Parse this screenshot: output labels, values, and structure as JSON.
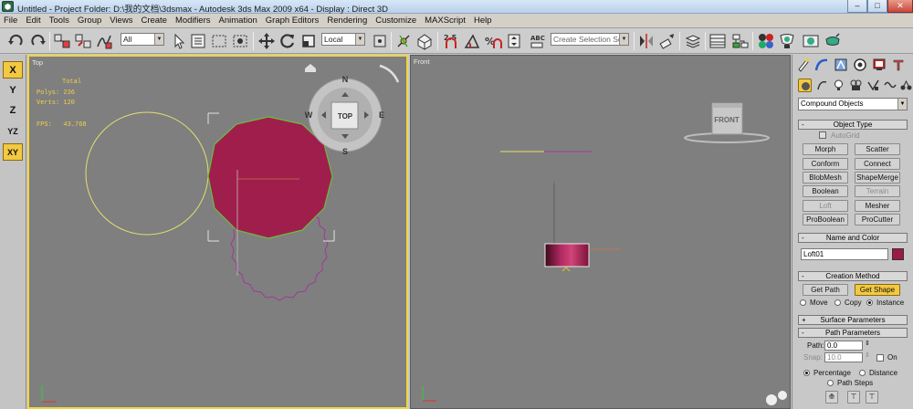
{
  "window": {
    "title": "Untitled      - Project Folder: D:\\我的文档\\3dsmax      - Autodesk 3ds Max  2009 x64      - Display : Direct 3D",
    "app_icon": "3ds-max-icon",
    "controls": {
      "minimize": "–",
      "maximize": "□",
      "close": "✕"
    }
  },
  "menubar": {
    "items": [
      "File",
      "Edit",
      "Tools",
      "Group",
      "Views",
      "Create",
      "Modifiers",
      "Animation",
      "Graph Editors",
      "Rendering",
      "Customize",
      "MAXScript",
      "Help"
    ]
  },
  "toolbar": {
    "selection_filter": "All",
    "reference_coord": "Local",
    "named_selection_placeholder": "Create Selection Set",
    "icons": [
      "undo-icon",
      "redo-icon",
      "select-link-icon",
      "unlink-icon",
      "bind-space-warp-icon",
      "select-object-icon",
      "select-by-name-icon",
      "rectangle-selection-icon",
      "window-crossing-icon",
      "move-icon",
      "rotate-icon",
      "scale-icon",
      "pivot-center-icon",
      "manipulate-icon",
      "keyboard-shortcut-icon",
      "snap-toggle-icon",
      "angle-snap-icon",
      "percent-snap-icon",
      "spinner-snap-icon",
      "edit-named-sel-icon",
      "mirror-icon",
      "align-icon",
      "layer-manager-icon",
      "curve-editor-icon",
      "schematic-view-icon",
      "material-editor-icon",
      "render-setup-icon",
      "render-frame-icon",
      "quick-render-icon"
    ]
  },
  "axis_constraints": {
    "buttons": [
      "X",
      "Y",
      "Z",
      "YZ",
      "XY"
    ],
    "active": "XY",
    "highlighted": "X"
  },
  "viewports": {
    "top": {
      "label": "Top",
      "stats": {
        "heading": "Total",
        "polys": "Polys: 236",
        "verts": "Verts: 120",
        "fps": "FPS:   43.768"
      },
      "viewcube_label": "TOP",
      "compass": {
        "n": "N",
        "s": "S",
        "e": "E",
        "w": "W"
      }
    },
    "front": {
      "label": "Front",
      "viewcube_label": "FRONT"
    },
    "colors": {
      "shape_fill": "#a01e4c",
      "circle_line": "#e0e070",
      "selection_green": "#6abf3c",
      "star_line": "#a0389a"
    }
  },
  "command_panel": {
    "tab_icons": [
      "create-icon",
      "modify-icon",
      "hierarchy-icon",
      "motion-icon",
      "display-icon",
      "utilities-icon"
    ],
    "sub_icons": [
      "geometry-icon",
      "shapes-icon",
      "lights-icon",
      "cameras-icon",
      "helpers-icon",
      "space-warps-icon",
      "systems-icon"
    ],
    "category": "Compound Objects",
    "object_type": {
      "header": "Object Type",
      "autogrid": "AutoGrid",
      "buttons": [
        "Morph",
        "Scatter",
        "Conform",
        "Connect",
        "BlobMesh",
        "ShapeMerge",
        "Boolean",
        "Terrain",
        "Loft",
        "Mesher",
        "ProBoolean",
        "ProCutter"
      ],
      "disabled": [
        "Terrain",
        "Loft"
      ]
    },
    "name_and_color": {
      "header": "Name and Color",
      "name": "Loft01",
      "color": "#9c1a44"
    },
    "creation_method": {
      "header": "Creation Method",
      "get_path": "Get Path",
      "get_shape": "Get Shape",
      "options": [
        "Move",
        "Copy",
        "Instance"
      ],
      "selected": "Instance"
    },
    "surface_parameters": {
      "header": "Surface Parameters"
    },
    "path_parameters": {
      "header": "Path Parameters",
      "path_label": "Path:",
      "path_value": "0.0",
      "snap_label": "Snap:",
      "snap_value": "10.0",
      "on_label": "On",
      "percentage": "Percentage",
      "distance": "Distance",
      "path_steps": "Path Steps",
      "selected": "Percentage"
    }
  }
}
